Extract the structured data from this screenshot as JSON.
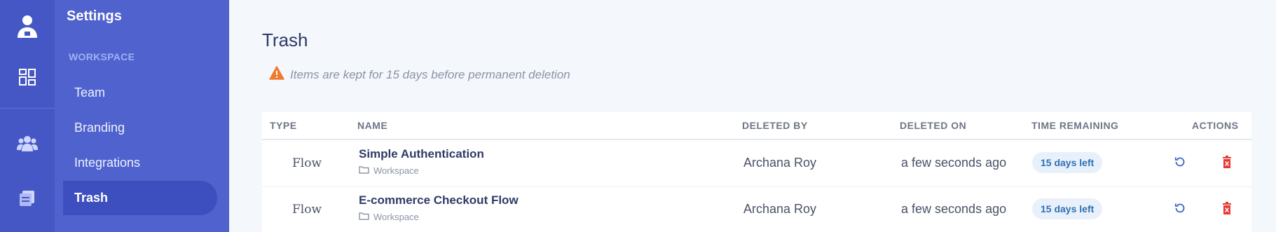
{
  "colors": {
    "rail": "#4557c4",
    "sidebar": "#4f62cd",
    "sidebar_active": "#3d4fbf",
    "warning": "#f07a2f",
    "delete": "#e53935",
    "restore": "#3f63c8",
    "badge_bg": "#e8f1fb",
    "badge_text": "#2f6fb5"
  },
  "rail": {
    "items": [
      {
        "icon": "user-icon"
      },
      {
        "icon": "dashboard-icon"
      },
      {
        "icon": "team-icon"
      },
      {
        "icon": "documents-icon"
      }
    ]
  },
  "sidebar": {
    "title": "Settings",
    "section_label": "WORKSPACE",
    "items": [
      {
        "label": "Team",
        "active": false
      },
      {
        "label": "Branding",
        "active": false
      },
      {
        "label": "Integrations",
        "active": false
      },
      {
        "label": "Trash",
        "active": true
      }
    ]
  },
  "main": {
    "title": "Trash",
    "notice": "Items are kept for 15 days before permanent deletion",
    "notice_icon": "warning-icon",
    "table": {
      "headers": [
        "TYPE",
        "NAME",
        "DELETED BY",
        "DELETED ON",
        "TIME REMAINING",
        "ACTIONS"
      ],
      "rows": [
        {
          "type": "Flow",
          "name": "Simple Authentication",
          "location": "Workspace",
          "deleted_by": "Archana Roy",
          "deleted_on": "a few seconds ago",
          "time_remaining": "15 days left",
          "actions": [
            "restore-icon",
            "delete-icon"
          ]
        },
        {
          "type": "Flow",
          "name": "E-commerce Checkout Flow",
          "location": "Workspace",
          "deleted_by": "Archana Roy",
          "deleted_on": "a few seconds ago",
          "time_remaining": "15 days left",
          "actions": [
            "restore-icon",
            "delete-icon"
          ]
        }
      ]
    }
  }
}
